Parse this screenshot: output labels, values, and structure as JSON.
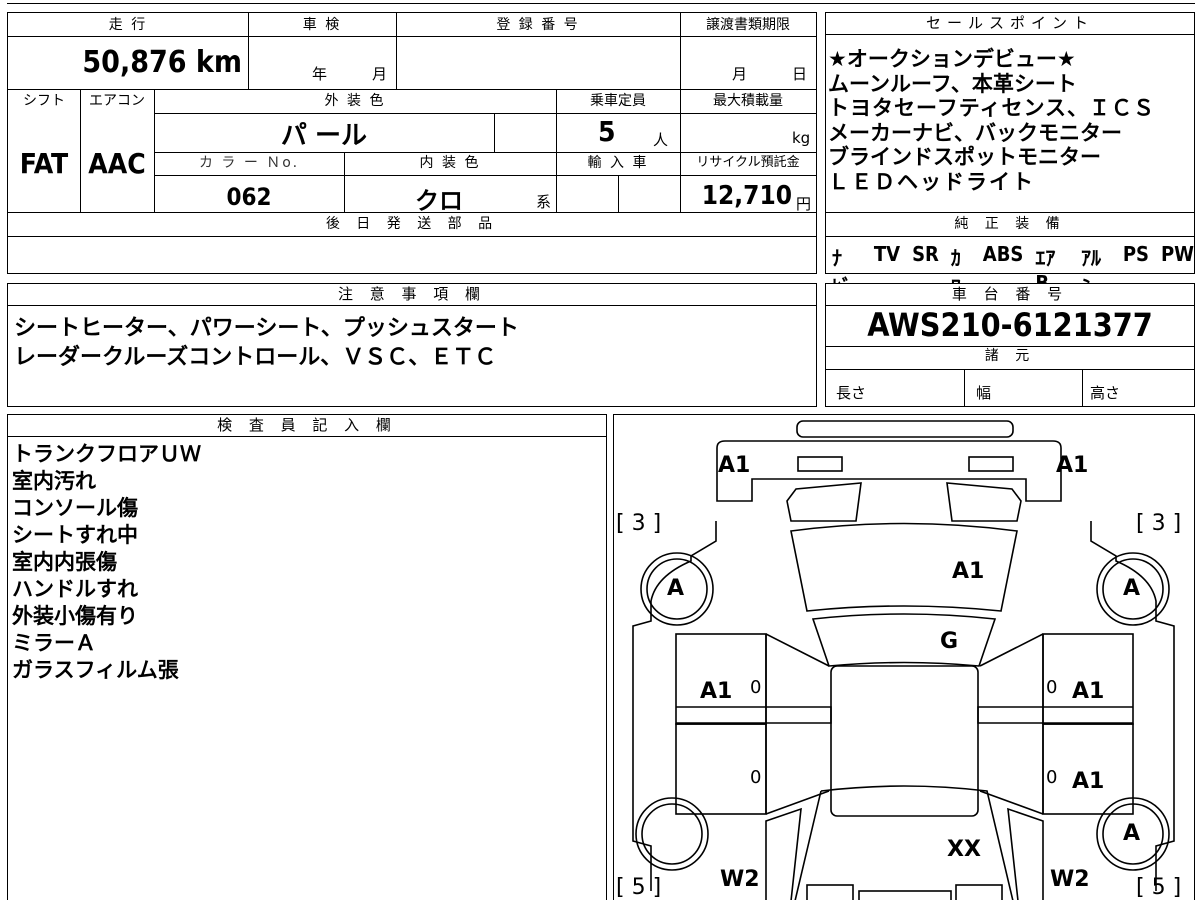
{
  "main": {
    "mileage_label": "走 行",
    "mileage_value": "50,876 km",
    "inspection_label": "車 検",
    "year_unit": "年",
    "month_unit": "月",
    "registration_label": "登 録 番 号",
    "transfer_deadline_label": "譲渡書類期限",
    "transfer_month": "月",
    "transfer_day": "日",
    "shift_label": "シフト",
    "shift_value": "FAT",
    "aircon_label": "エアコン",
    "aircon_value": "AAC",
    "exterior_color_label": "外 装 色",
    "exterior_color_value": "パ ール",
    "capacity_label": "乗車定員",
    "capacity_value": "5",
    "capacity_unit": "人",
    "max_load_label": "最大積載量",
    "max_load_unit": "kg",
    "color_no_label": "カ ラ ー Ｎo.",
    "color_no_value": "062",
    "interior_color_label": "内 装 色",
    "interior_color_value": "クロ",
    "interior_color_suffix": "系",
    "import_label": "輸 入 車",
    "recycle_label": "リサイクル預託金",
    "recycle_value": "12,710",
    "recycle_unit": "円",
    "later_parts_label": "後 日 発 送 部 品"
  },
  "sales": {
    "label": "セールスポイント",
    "lines": [
      "★オークションデビュー★",
      "ムーンルーフ、本革シート",
      "トヨタセーフティセンス、ＩＣＳ",
      "メーカーナビ、バックモニター",
      "ブラインドスポットモニター",
      "ＬＥＤヘッドライト"
    ]
  },
  "equipment": {
    "label": "純 正 装 備",
    "items": [
      "ﾅﾋﾞ",
      "TV",
      "SR",
      "ｶﾜ",
      "ABS",
      "ｴｱB",
      "ｱﾙﾐ",
      "PS",
      "PW"
    ]
  },
  "notes": {
    "label": "注 意 事 項 欄",
    "lines": [
      "シートヒーター、パワーシート、プッシュスタート",
      "レーダークルーズコントロール、ＶＳＣ、ＥＴＣ"
    ]
  },
  "chassis": {
    "label": "車 台 番 号",
    "value": "AWS210-6121377",
    "specs_label": "諸 元",
    "length_label": "長さ",
    "width_label": "幅",
    "height_label": "高さ"
  },
  "inspector": {
    "label": "検 査 員 記 入 欄",
    "lines": [
      "トランクフロアＵＷ",
      "室内汚れ",
      "コンソール傷",
      "シートすれ中",
      "室内内張傷",
      "ハンドルすれ",
      "外装小傷有り",
      "ミラーＡ",
      "ガラスフィルム張"
    ]
  },
  "diagram": {
    "rear_left": "A1",
    "rear_right": "A1",
    "bracket_left_top": "[ 3 ]",
    "bracket_right_top": "[ 3 ]",
    "bracket_left_bottom": "[ 5 ]",
    "bracket_right_bottom": "[ 5 ]",
    "wheel_rear_left": "A",
    "wheel_rear_right": "A",
    "wheel_front_right": "A",
    "roof": "A1",
    "rear_glass": "G",
    "door_rl": "A1",
    "door_rr": "A1",
    "door_fr": "A1",
    "zero_rl": "0",
    "zero_rr": "0",
    "zero_fl": "0",
    "zero_fr": "0",
    "hood": "XX",
    "fender_fl": "W2",
    "fender_fr": "W2"
  }
}
